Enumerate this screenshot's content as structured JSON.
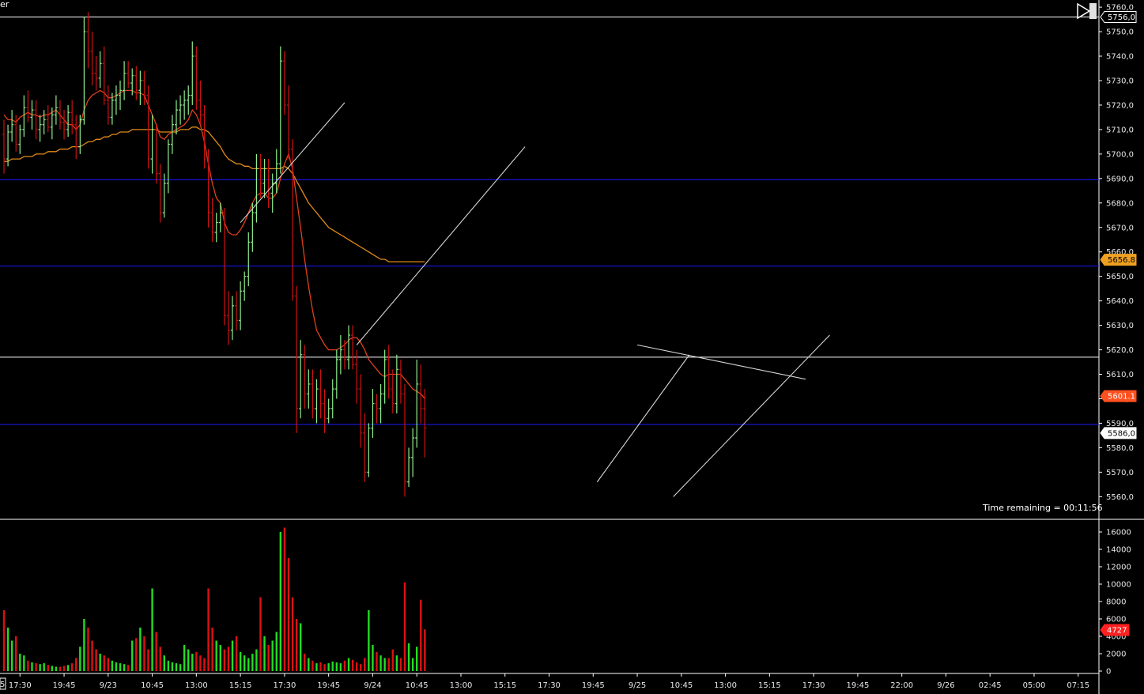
{
  "window": {
    "title_fragment": "er",
    "corner_fragment": "5",
    "buttons": [
      "play-icon",
      "pause-icon"
    ]
  },
  "status": {
    "time_remaining": "Time remaining = 00:11:56"
  },
  "colors": {
    "background": "#000000",
    "up_bar": "#90ee90",
    "down_bar": "#cc1111",
    "fast_ma": "#e0401a",
    "slow_ma": "#e08a1a",
    "level_blue": "#1a1aff",
    "level_white": "#ffffff",
    "trendline": "#d8d8d8",
    "tag_slow_ma": "#f0a020",
    "tag_fast_ma": "#ff5020",
    "tag_last": "#ffffff",
    "tag_volume": "#ff2020"
  },
  "chart_data": [
    {
      "type": "ohlc",
      "panel": "price",
      "y_tick_labels": [
        "5760,0",
        "5750,0",
        "5740,0",
        "5730,0",
        "5720,0",
        "5710,0",
        "5700,0",
        "5690,0",
        "5680,0",
        "5670,0",
        "5660,0",
        "5650,0",
        "5640,0",
        "5630,0",
        "5620,0",
        "5610,0",
        "5600,0",
        "5590,0",
        "5580,0",
        "5570,0",
        "5560,0"
      ],
      "y_ticks": [
        5760,
        5750,
        5740,
        5730,
        5720,
        5710,
        5700,
        5690,
        5680,
        5670,
        5660,
        5650,
        5640,
        5630,
        5620,
        5610,
        5600,
        5590,
        5580,
        5570,
        5560
      ],
      "ylim": [
        5553,
        5761
      ],
      "x_tick_labels": [
        "17:30",
        "19:45",
        "9/23",
        "10:45",
        "13:00",
        "15:15",
        "17:30",
        "19:45",
        "9/24",
        "10:45",
        "13:00",
        "15:15",
        "17:30",
        "19:45",
        "9/25",
        "10:45",
        "13:00",
        "15:15",
        "17:30",
        "19:45",
        "22:00",
        "9/26",
        "02:45",
        "05:00",
        "07:15"
      ],
      "x_range_bars": [
        0,
        200
      ],
      "x_tick_bars": [
        4,
        15,
        26,
        37,
        48,
        59,
        70,
        81,
        92,
        103,
        114,
        125,
        136,
        147,
        158,
        169,
        180,
        191,
        202,
        213,
        224,
        235,
        246,
        257,
        268
      ],
      "bars": [
        [
          5708,
          5714,
          5692,
          5698
        ],
        [
          5698,
          5712,
          5695,
          5709
        ],
        [
          5709,
          5718,
          5705,
          5712
        ],
        [
          5712,
          5716,
          5701,
          5704
        ],
        [
          5704,
          5712,
          5700,
          5710
        ],
        [
          5710,
          5724,
          5707,
          5719
        ],
        [
          5719,
          5726,
          5713,
          5715
        ],
        [
          5715,
          5722,
          5710,
          5718
        ],
        [
          5718,
          5722,
          5706,
          5710
        ],
        [
          5710,
          5716,
          5705,
          5712
        ],
        [
          5712,
          5718,
          5708,
          5714
        ],
        [
          5714,
          5720,
          5709,
          5711
        ],
        [
          5711,
          5719,
          5706,
          5716
        ],
        [
          5716,
          5724,
          5712,
          5719
        ],
        [
          5719,
          5722,
          5710,
          5713
        ],
        [
          5713,
          5718,
          5706,
          5710
        ],
        [
          5710,
          5720,
          5707,
          5717
        ],
        [
          5717,
          5722,
          5708,
          5712
        ],
        [
          5712,
          5716,
          5698,
          5703
        ],
        [
          5703,
          5716,
          5700,
          5714
        ],
        [
          5714,
          5756,
          5712,
          5750
        ],
        [
          5750,
          5758,
          5735,
          5742
        ],
        [
          5742,
          5750,
          5728,
          5733
        ],
        [
          5733,
          5740,
          5726,
          5731
        ],
        [
          5731,
          5742,
          5727,
          5737
        ],
        [
          5737,
          5744,
          5720,
          5722
        ],
        [
          5722,
          5728,
          5712,
          5715
        ],
        [
          5715,
          5725,
          5712,
          5722
        ],
        [
          5722,
          5728,
          5716,
          5724
        ],
        [
          5724,
          5730,
          5718,
          5726
        ],
        [
          5726,
          5738,
          5722,
          5733
        ],
        [
          5733,
          5738,
          5727,
          5729
        ],
        [
          5729,
          5735,
          5724,
          5732
        ],
        [
          5732,
          5736,
          5722,
          5726
        ],
        [
          5726,
          5734,
          5720,
          5730
        ],
        [
          5730,
          5734,
          5720,
          5724
        ],
        [
          5724,
          5728,
          5694,
          5698
        ],
        [
          5698,
          5716,
          5692,
          5710
        ],
        [
          5710,
          5712,
          5688,
          5692
        ],
        [
          5692,
          5696,
          5672,
          5676
        ],
        [
          5676,
          5692,
          5674,
          5688
        ],
        [
          5688,
          5706,
          5684,
          5704
        ],
        [
          5704,
          5716,
          5700,
          5712
        ],
        [
          5712,
          5722,
          5708,
          5718
        ],
        [
          5718,
          5724,
          5712,
          5720
        ],
        [
          5720,
          5726,
          5714,
          5722
        ],
        [
          5722,
          5728,
          5716,
          5724
        ],
        [
          5724,
          5746,
          5720,
          5740
        ],
        [
          5740,
          5744,
          5718,
          5722
        ],
        [
          5722,
          5730,
          5712,
          5716
        ],
        [
          5716,
          5720,
          5694,
          5698
        ],
        [
          5698,
          5702,
          5670,
          5676
        ],
        [
          5676,
          5682,
          5664,
          5668
        ],
        [
          5668,
          5676,
          5664,
          5672
        ],
        [
          5672,
          5680,
          5668,
          5676
        ],
        [
          5676,
          5678,
          5630,
          5634
        ],
        [
          5634,
          5644,
          5622,
          5628
        ],
        [
          5628,
          5642,
          5624,
          5638
        ],
        [
          5638,
          5644,
          5628,
          5632
        ],
        [
          5632,
          5648,
          5628,
          5644
        ],
        [
          5644,
          5652,
          5640,
          5650
        ],
        [
          5650,
          5668,
          5646,
          5664
        ],
        [
          5664,
          5680,
          5660,
          5676
        ],
        [
          5676,
          5700,
          5672,
          5694
        ],
        [
          5694,
          5700,
          5682,
          5688
        ],
        [
          5688,
          5698,
          5682,
          5694
        ],
        [
          5694,
          5698,
          5678,
          5684
        ],
        [
          5684,
          5692,
          5676,
          5688
        ],
        [
          5688,
          5702,
          5684,
          5696
        ],
        [
          5696,
          5744,
          5692,
          5738
        ],
        [
          5738,
          5742,
          5716,
          5720
        ],
        [
          5720,
          5728,
          5698,
          5702
        ],
        [
          5702,
          5706,
          5640,
          5642
        ],
        [
          5642,
          5646,
          5586,
          5596
        ],
        [
          5596,
          5624,
          5592,
          5618
        ],
        [
          5618,
          5622,
          5596,
          5602
        ],
        [
          5602,
          5612,
          5596,
          5606
        ],
        [
          5606,
          5612,
          5592,
          5596
        ],
        [
          5596,
          5608,
          5590,
          5604
        ],
        [
          5604,
          5612,
          5592,
          5598
        ],
        [
          5598,
          5604,
          5586,
          5592
        ],
        [
          5592,
          5600,
          5590,
          5596
        ],
        [
          5596,
          5608,
          5592,
          5604
        ],
        [
          5604,
          5620,
          5600,
          5616
        ],
        [
          5616,
          5626,
          5610,
          5620
        ],
        [
          5620,
          5624,
          5612,
          5616
        ],
        [
          5616,
          5630,
          5612,
          5626
        ],
        [
          5626,
          5630,
          5612,
          5614
        ],
        [
          5614,
          5620,
          5598,
          5604
        ],
        [
          5604,
          5610,
          5580,
          5586
        ],
        [
          5586,
          5594,
          5566,
          5570
        ],
        [
          5570,
          5590,
          5568,
          5588
        ],
        [
          5588,
          5604,
          5584,
          5598
        ],
        [
          5598,
          5602,
          5590,
          5596
        ],
        [
          5596,
          5606,
          5590,
          5602
        ],
        [
          5602,
          5620,
          5598,
          5616
        ],
        [
          5616,
          5622,
          5600,
          5604
        ],
        [
          5604,
          5612,
          5594,
          5598
        ],
        [
          5598,
          5618,
          5594,
          5612
        ],
        [
          5612,
          5616,
          5598,
          5602
        ],
        [
          5602,
          5606,
          5560,
          5566
        ],
        [
          5566,
          5580,
          5564,
          5576
        ],
        [
          5576,
          5588,
          5568,
          5584
        ],
        [
          5584,
          5616,
          5580,
          5606
        ],
        [
          5606,
          5614,
          5590,
          5596
        ],
        [
          5596,
          5604,
          5576,
          5588
        ]
      ],
      "overlays": {
        "fast_ma": [
          5716,
          5714,
          5714,
          5713,
          5715,
          5716,
          5717,
          5716,
          5716,
          5715,
          5716,
          5716,
          5717,
          5718,
          5716,
          5714,
          5712,
          5712,
          5710,
          5712,
          5718,
          5722,
          5724,
          5725,
          5726,
          5725,
          5723,
          5723,
          5724,
          5725,
          5726,
          5726,
          5726,
          5725,
          5725,
          5724,
          5720,
          5716,
          5712,
          5707,
          5706,
          5708,
          5709,
          5710,
          5711,
          5712,
          5714,
          5718,
          5716,
          5712,
          5705,
          5696,
          5688,
          5682,
          5680,
          5672,
          5668,
          5667,
          5667,
          5669,
          5672,
          5676,
          5680,
          5683,
          5684,
          5684,
          5682,
          5682,
          5684,
          5690,
          5696,
          5700,
          5694,
          5682,
          5670,
          5657,
          5646,
          5636,
          5628,
          5625,
          5622,
          5620,
          5620,
          5620,
          5621,
          5622,
          5624,
          5625,
          5625,
          5623,
          5620,
          5616,
          5614,
          5612,
          5610,
          5609,
          5610,
          5610,
          5610,
          5610,
          5608,
          5606,
          5604,
          5603,
          5602,
          5600
        ],
        "slow_ma": [
          5697,
          5697,
          5698,
          5698,
          5698,
          5699,
          5699,
          5699,
          5700,
          5700,
          5700,
          5701,
          5701,
          5701,
          5702,
          5702,
          5702,
          5703,
          5703,
          5703,
          5704,
          5705,
          5705,
          5706,
          5706,
          5707,
          5707,
          5708,
          5708,
          5709,
          5709,
          5709,
          5710,
          5710,
          5710,
          5710,
          5710,
          5710,
          5710,
          5709,
          5709,
          5709,
          5709,
          5709,
          5710,
          5710,
          5710,
          5711,
          5711,
          5710,
          5710,
          5709,
          5707,
          5705,
          5703,
          5700,
          5698,
          5697,
          5696,
          5696,
          5695,
          5695,
          5694,
          5694,
          5694,
          5694,
          5694,
          5694,
          5694,
          5694,
          5695,
          5694,
          5692,
          5689,
          5686,
          5683,
          5680,
          5678,
          5676,
          5674,
          5672,
          5670,
          5669,
          5668,
          5667,
          5666,
          5665,
          5664,
          5663,
          5662,
          5661,
          5660,
          5659,
          5658,
          5657,
          5657,
          5656,
          5656,
          5656,
          5656,
          5656,
          5656,
          5656,
          5656,
          5656,
          5656
        ]
      },
      "levels": [
        {
          "value": 5756.0,
          "color": "white"
        },
        {
          "value": 5689.5,
          "color": "blue"
        },
        {
          "value": 5654.2,
          "color": "blue"
        },
        {
          "value": 5617.0,
          "color": "white"
        },
        {
          "value": 5589.5,
          "color": "blue"
        }
      ],
      "trendlines": [
        {
          "from": [
            59,
            5672
          ],
          "to": [
            85,
            5721
          ]
        },
        {
          "from": [
            88,
            5622
          ],
          "to": [
            130,
            5703
          ]
        },
        {
          "from": [
            148,
            5566
          ],
          "to": [
            171,
            5618
          ]
        },
        {
          "from": [
            158,
            5622
          ],
          "to": [
            200,
            5608
          ]
        },
        {
          "from": [
            167,
            5560
          ],
          "to": [
            206,
            5626
          ]
        }
      ],
      "value_tags": [
        {
          "label": "5756,0",
          "value": 5756.0,
          "style": "boxed"
        },
        {
          "label": "5656.8",
          "value": 5656.8,
          "style": "slow"
        },
        {
          "label": "5601.1",
          "value": 5601.1,
          "style": "fast"
        },
        {
          "label": "5586,0",
          "value": 5586.0,
          "style": "last"
        }
      ]
    },
    {
      "type": "bar",
      "panel": "volume",
      "y_tick_labels": [
        "16000",
        "14000",
        "12000",
        "10000",
        "8000",
        "6000",
        "4000",
        "2000",
        "0"
      ],
      "y_ticks": [
        16000,
        14000,
        12000,
        10000,
        8000,
        6000,
        4000,
        2000,
        0
      ],
      "ylim": [
        0,
        17000
      ],
      "values": [
        7000,
        5000,
        3500,
        4000,
        2000,
        1800,
        1200,
        1000,
        900,
        800,
        900,
        700,
        600,
        500,
        500,
        600,
        700,
        900,
        1500,
        2800,
        6000,
        5000,
        3500,
        2500,
        2000,
        1800,
        1500,
        1200,
        1000,
        900,
        800,
        700,
        3500,
        3800,
        5000,
        4000,
        2500,
        9500,
        4500,
        2800,
        1800,
        1200,
        1000,
        900,
        800,
        3000,
        2500,
        2000,
        2200,
        1800,
        1500,
        9500,
        5000,
        3500,
        3000,
        2500,
        2800,
        3500,
        4000,
        2200,
        1800,
        1500,
        2000,
        2500,
        8500,
        4000,
        3000,
        3500,
        4500,
        16000,
        16500,
        13000,
        8500,
        6000,
        5500,
        2000,
        1500,
        1200,
        900,
        1000,
        800,
        900,
        1100,
        1000,
        900,
        1200,
        1500,
        1300,
        1000,
        800,
        1500,
        7000,
        3000,
        2200,
        1800,
        1500,
        1500,
        2500,
        1800,
        1500,
        10200,
        3200,
        1500,
        2800,
        8200,
        4800
      ],
      "last_value_label": "4727"
    }
  ]
}
